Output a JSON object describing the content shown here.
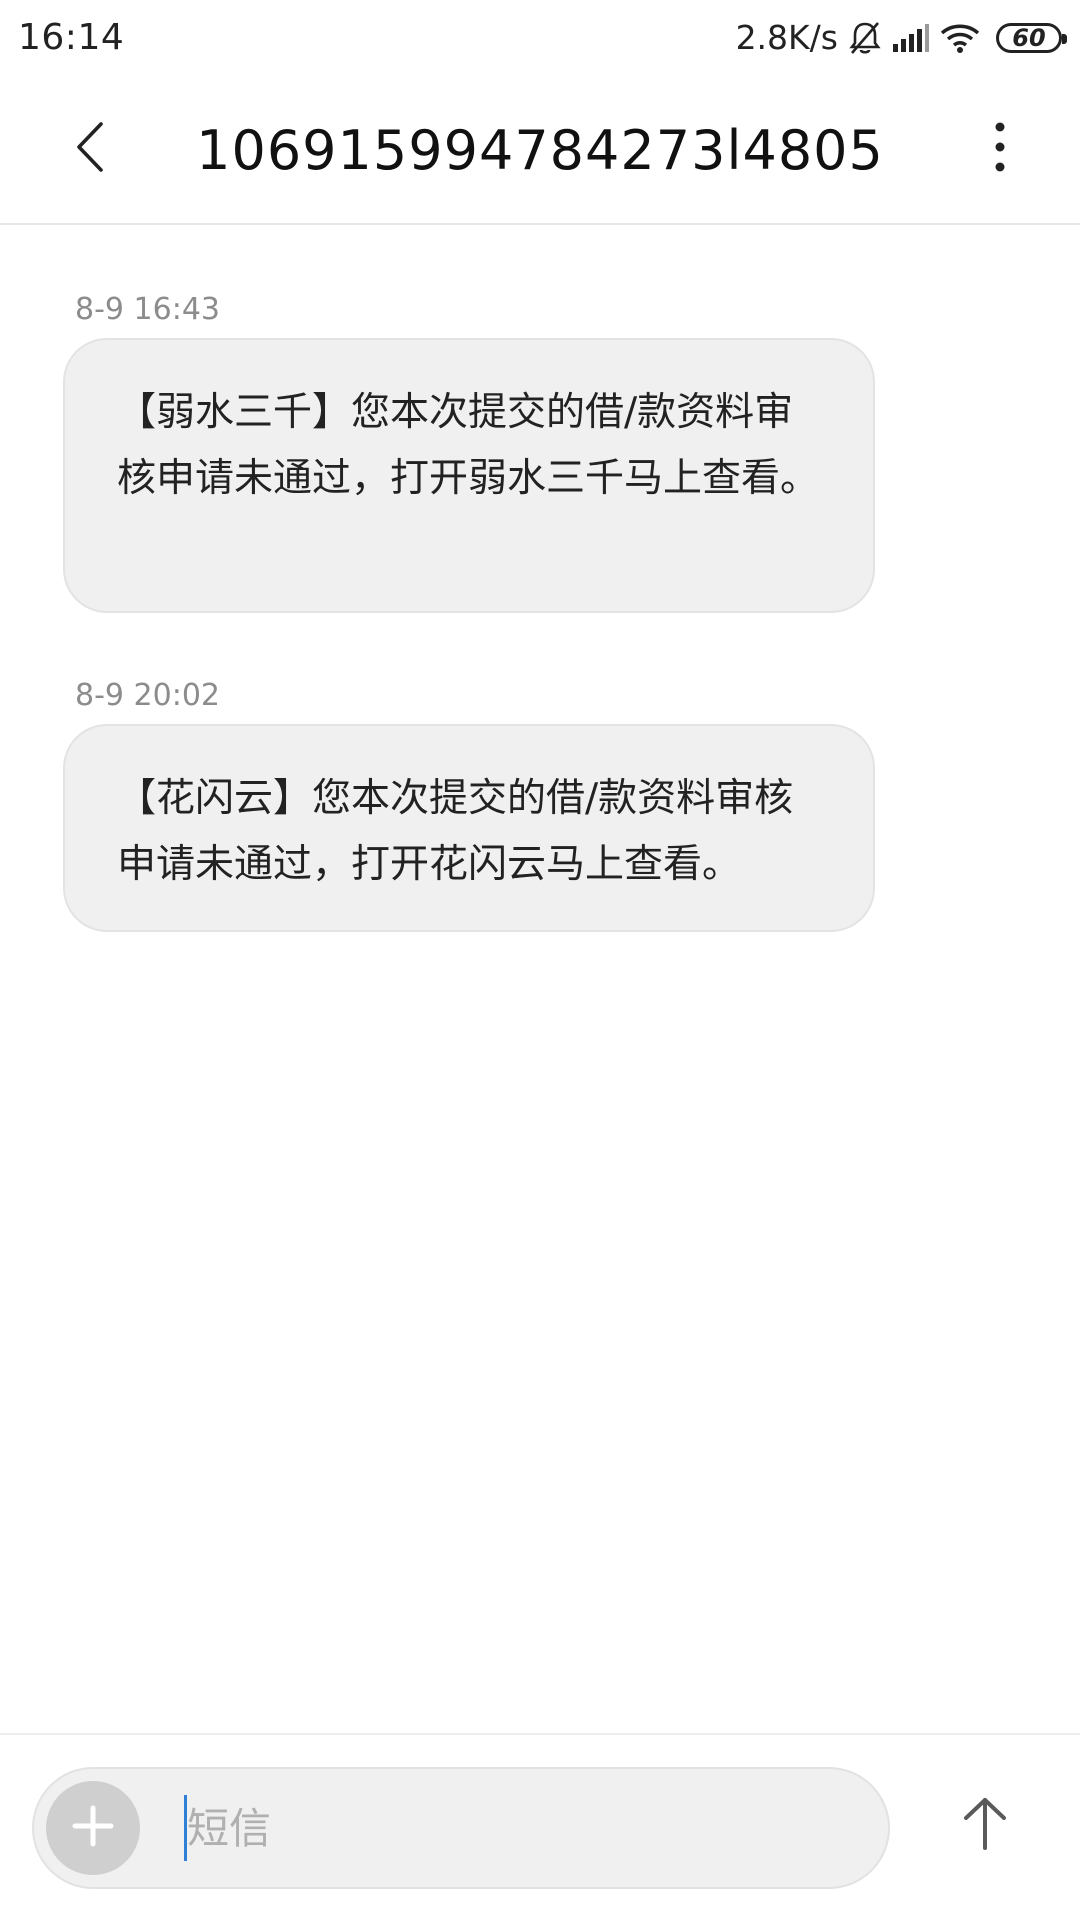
{
  "status_bar": {
    "time": "16:14",
    "network_speed": "2.8K/s",
    "battery": "60"
  },
  "header": {
    "title": "106915994784273l4805"
  },
  "messages": [
    {
      "timestamp": "8-9 16:43",
      "text": "【弱水三千】您本次提交的借/款资料审核申请未通过，打开弱水三千马上查看。"
    },
    {
      "timestamp": "8-9 20:02",
      "text": "【花闪云】您本次提交的借/款资料审核申请未通过，打开花闪云马上查看。"
    }
  ],
  "composer": {
    "placeholder": "短信"
  },
  "icons": {
    "back": "chevron-left-icon",
    "menu": "more-vertical-icon",
    "mute": "bell-off-icon",
    "signal": "signal-icon",
    "wifi": "wifi-icon",
    "battery": "battery-icon",
    "add": "plus-icon",
    "send": "arrow-up-icon"
  }
}
